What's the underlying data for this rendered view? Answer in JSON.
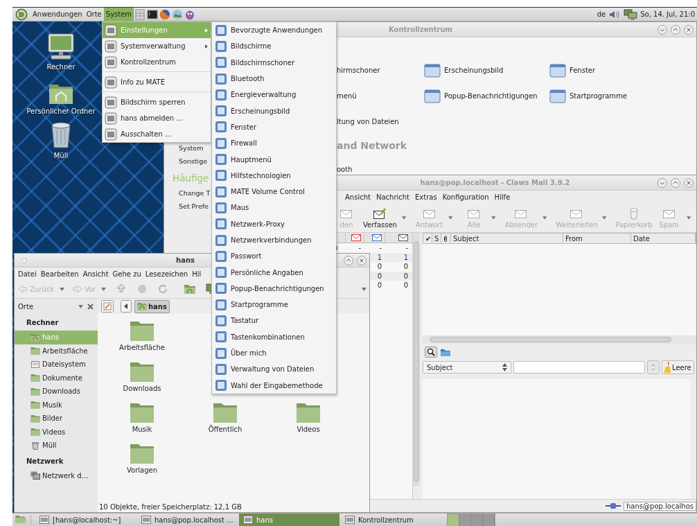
{
  "top_panel": {
    "menus": [
      {
        "label": "Anwendungen",
        "selected": false
      },
      {
        "label": "Orte",
        "selected": false
      },
      {
        "label": "System",
        "selected": true
      }
    ],
    "keyboard_layout": "de",
    "clock": "So, 14. Jul, 21:0"
  },
  "desktop_icons": [
    {
      "kind": "computer",
      "label": "Rechner"
    },
    {
      "kind": "home",
      "label": "Persönlicher Ordner"
    },
    {
      "kind": "trash",
      "label": "Müll"
    }
  ],
  "control_center": {
    "title": "Kontrollzentrum",
    "sidebar_items": [
      "System",
      "Sonstige"
    ],
    "common_heading": "Häufige",
    "common_items": [
      "Change T",
      "Set Prefe"
    ],
    "sections": [
      {
        "items": [
          "hirmschoner",
          "Erscheinungsbild",
          "Fenster",
          "menü",
          "Popup-Benachrichtigungen",
          "Startprogramme",
          "ltung von Dateien"
        ]
      },
      {
        "heading": "and Network",
        "items": [
          "ooth"
        ]
      }
    ]
  },
  "claws_mail": {
    "title": "hans@pop.localhost - Claws Mail 3.9.2",
    "menu": [
      "Ansicht",
      "Nachricht",
      "Extras",
      "Konfiguration",
      "Hilfe"
    ],
    "toolbar": [
      {
        "label": "den",
        "kind": "mail",
        "disabled": true,
        "dropdown": false
      },
      {
        "label": "Verfassen",
        "kind": "compose",
        "disabled": false,
        "dropdown": true
      },
      {
        "label": "Antwort",
        "kind": "mail",
        "disabled": true,
        "dropdown": true
      },
      {
        "label": "Alle",
        "kind": "mail",
        "disabled": true,
        "dropdown": true
      },
      {
        "label": "Absender",
        "kind": "mail",
        "disabled": true,
        "dropdown": true
      },
      {
        "label": "Weiterleiten",
        "kind": "mail",
        "disabled": true,
        "dropdown": true
      },
      {
        "label": "Papierkorb",
        "kind": "trash",
        "disabled": true,
        "dropdown": false
      },
      {
        "label": "Spam",
        "kind": "mail",
        "disabled": true,
        "dropdown": true
      }
    ],
    "folder_rows": [
      {
        "column_1": ")",
        "column_2": "-",
        "column_3": "-",
        "column_4": "-",
        "unread": false
      },
      {
        "column_3": "1",
        "column_4": "1",
        "unread": true
      },
      {
        "column_3": "0",
        "column_4": "0",
        "unread": false
      },
      {
        "column_3": "0",
        "column_4": "0",
        "unread": false
      },
      {
        "column_3": "0",
        "column_4": "0",
        "unread": false
      }
    ],
    "message_columns": [
      {
        "kind": "text",
        "label": "✔"
      },
      {
        "kind": "text",
        "label": "S"
      },
      {
        "kind": "attachment"
      },
      {
        "kind": "text",
        "label": "Subject"
      },
      {
        "kind": "text",
        "label": "From"
      },
      {
        "kind": "text",
        "label": "Date"
      }
    ],
    "quick_search": {
      "field": "Subject",
      "clear_button": "Leere"
    },
    "status": "hans@pop.localhos"
  },
  "file_manager": {
    "title": "hans",
    "menu": [
      "Datei",
      "Bearbeiten",
      "Ansicht",
      "Gehe zu",
      "Lesezeichen",
      "Hil"
    ],
    "back": {
      "label": "Zurück",
      "disabled": true
    },
    "forward": {
      "label": "Vor",
      "disabled": true
    },
    "sidebar_title": "Orte",
    "path": "hans",
    "sections": [
      {
        "heading": "Rechner",
        "items": [
          {
            "label": "hans",
            "kind": "home",
            "selected": true
          },
          {
            "label": "Arbeitsfläche",
            "kind": "folder",
            "selected": false
          },
          {
            "label": "Dateisystem",
            "kind": "drive",
            "selected": false
          },
          {
            "label": "Dokumente",
            "kind": "folder",
            "selected": false
          },
          {
            "label": "Downloads",
            "kind": "folder",
            "selected": false
          },
          {
            "label": "Musik",
            "kind": "folder",
            "selected": false
          },
          {
            "label": "Bilder",
            "kind": "folder",
            "selected": false
          },
          {
            "label": "Videos",
            "kind": "folder",
            "selected": false
          },
          {
            "label": "Müll",
            "kind": "trash",
            "selected": false
          }
        ]
      },
      {
        "heading": "Netzwerk",
        "items": [
          {
            "label": "Netzwerk d...",
            "kind": "network",
            "selected": false
          }
        ]
      }
    ],
    "icon_rows": [
      [
        "Arbeitsfläche"
      ],
      [
        "Downloads"
      ],
      [
        "Musik",
        "Öffentlich",
        "Videos"
      ],
      [
        "Vorlagen"
      ]
    ],
    "status": "10 Objekte, freier Speicherplatz: 12,1 GB"
  },
  "system_menu": {
    "groups": [
      [
        {
          "label": "Einstellungen",
          "submenu": true,
          "selected": true
        },
        {
          "label": "Systemverwaltung",
          "submenu": true,
          "selected": false
        },
        {
          "label": "Kontrollzentrum",
          "submenu": false,
          "selected": false
        }
      ],
      [
        {
          "label": "Info zu MATE",
          "submenu": false,
          "selected": false
        }
      ],
      [
        {
          "label": "Bildschirm sperren",
          "submenu": false,
          "selected": false
        },
        {
          "label": "hans abmelden ...",
          "submenu": false,
          "selected": false
        },
        {
          "label": "Ausschalten ...",
          "submenu": false,
          "selected": false
        }
      ]
    ]
  },
  "settings_submenu": {
    "items": [
      "Bevorzugte Anwendungen",
      "Bildschirme",
      "Bildschirmschoner",
      "Bluetooth",
      "Energieverwaltung",
      "Erscheinungsbild",
      "Fenster",
      "Firewall",
      "Hauptmenü",
      "Hilfstechnologien",
      "MATE Volume Control",
      "Maus",
      "Netzwerk-Proxy",
      "Netzwerkverbindungen",
      "Passwort",
      "Persönliche Angaben",
      "Popup-Benachrichtigungen",
      "Startprogramme",
      "Tastatur",
      "Tastenkombinationen",
      "Über mich",
      "Verwaltung von Dateien",
      "Wahl der Eingabemethode"
    ]
  },
  "taskbar": {
    "windows": [
      {
        "label": "[hans@localhost:~]",
        "selected": false
      },
      {
        "label": "hans@pop.localhost ...",
        "selected": false
      },
      {
        "label": "hans",
        "selected": true
      },
      {
        "label": "Kontrollzentrum",
        "selected": false
      }
    ],
    "workspaces": [
      {
        "selected": true
      },
      {
        "selected": false
      },
      {
        "selected": false
      },
      {
        "selected": false
      }
    ]
  }
}
